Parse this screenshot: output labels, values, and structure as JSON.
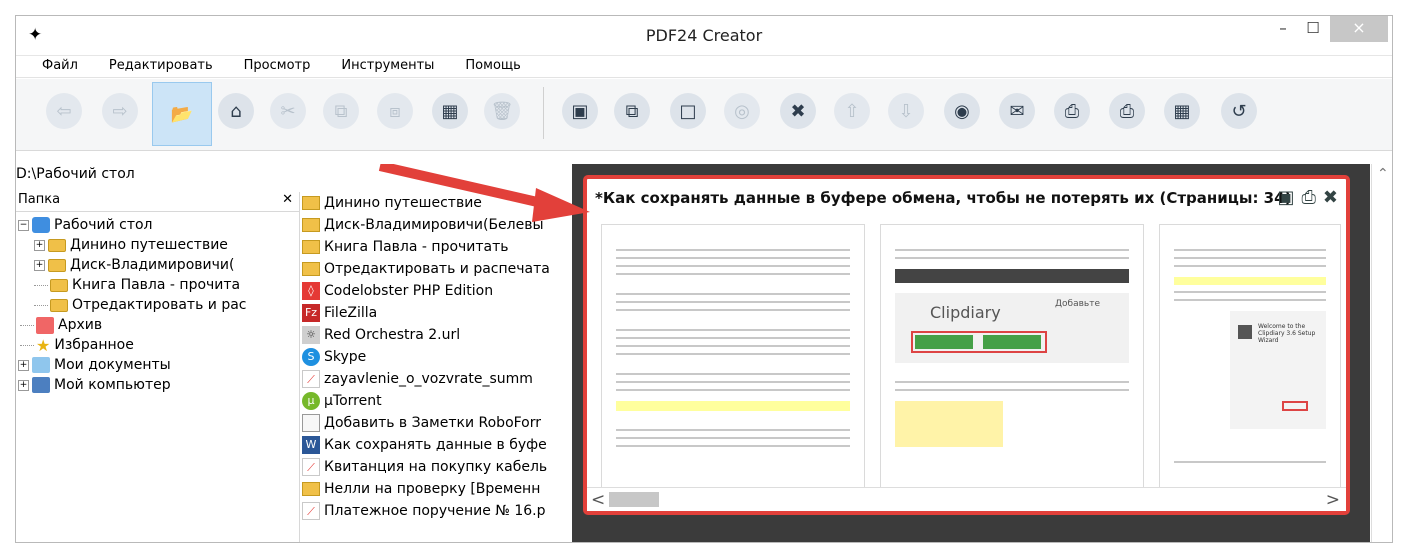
{
  "window": {
    "title": "PDF24 Creator",
    "controls": {
      "minimize": "–",
      "maximize": "☐",
      "close": "×"
    }
  },
  "menu": [
    "Файл",
    "Редактировать",
    "Просмотр",
    "Инструменты",
    "Помощь"
  ],
  "path": "D:\\Рабочий стол",
  "folder_panel": {
    "title": "Папка",
    "close": "✕",
    "items": [
      {
        "label": "Рабочий стол",
        "level": 0,
        "icon": "desktop-icon"
      },
      {
        "label": "Динино путешествие",
        "level": 1,
        "icon": "folder-icon"
      },
      {
        "label": "Диск-Владимировичи(",
        "level": 1,
        "icon": "folder-icon"
      },
      {
        "label": "Книга Павла  - прочита",
        "level": 1,
        "icon": "folder-icon"
      },
      {
        "label": "Отредактировать и рас",
        "level": 1,
        "icon": "folder-icon"
      },
      {
        "label": "Архив",
        "level": 0,
        "icon": "archive-icon"
      },
      {
        "label": "Избранное",
        "level": 0,
        "icon": "star-icon"
      },
      {
        "label": "Мои документы",
        "level": 0,
        "icon": "documents-icon"
      },
      {
        "label": "Мой компьютер",
        "level": 0,
        "icon": "computer-icon"
      }
    ]
  },
  "files": [
    {
      "name": "Динино путешествие",
      "type": "folder"
    },
    {
      "name": "Диск-Владимировичи(Белевы",
      "type": "folder"
    },
    {
      "name": "Книга Павла  - прочитать",
      "type": "folder"
    },
    {
      "name": "Отредактировать и распечата",
      "type": "folder"
    },
    {
      "name": "Codelobster PHP Edition",
      "type": "code"
    },
    {
      "name": "FileZilla",
      "type": "filezilla"
    },
    {
      "name": "Red Orchestra 2.url",
      "type": "url"
    },
    {
      "name": "Skype",
      "type": "skype"
    },
    {
      "name": "zayavlenie_o_vozvrate_summ",
      "type": "pdf"
    },
    {
      "name": "μTorrent",
      "type": "torrent"
    },
    {
      "name": "Добавить в  Заметки RoboForr",
      "type": "note"
    },
    {
      "name": "Как сохранять данные в буфе",
      "type": "word"
    },
    {
      "name": "Квитанция на покупку кабель",
      "type": "pdf"
    },
    {
      "name": "Нелли на проверку [Временн",
      "type": "folder"
    },
    {
      "name": "Платежное поручение № 16.р",
      "type": "pdf"
    }
  ],
  "preview": {
    "title": "*Как сохранять данные в буфере обмена, чтобы не потерять их (Страницы: 34)",
    "page_snippets": [
      "Clipdiary",
      "Добавьте",
      "Welcome to the Clipdiary 3.6 Setup Wizard"
    ],
    "scroll_left": "<",
    "scroll_right": ">"
  },
  "colors": {
    "accent": "#e2403a",
    "toolbar_bg": "#f5f6f7",
    "selected": "#cce4f7"
  }
}
